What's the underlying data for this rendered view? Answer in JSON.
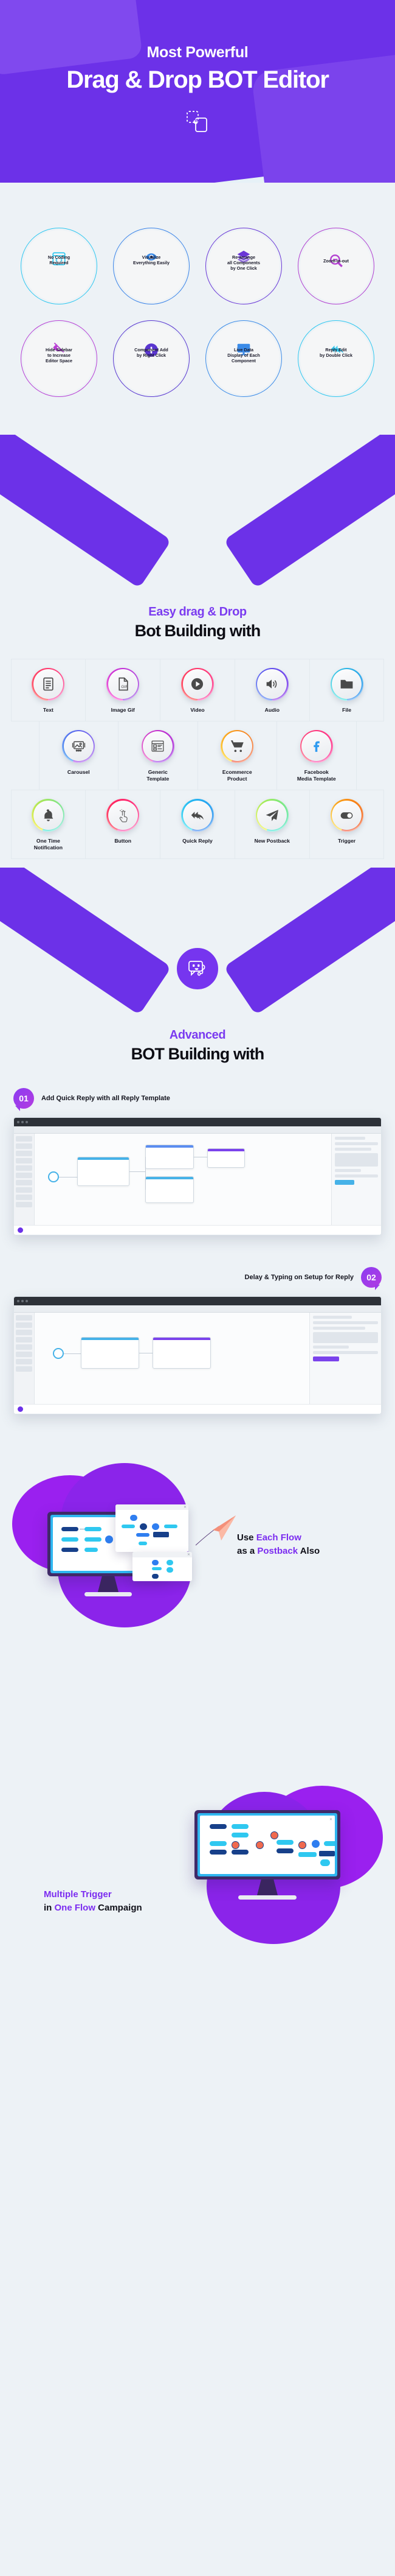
{
  "hero": {
    "subtitle": "Most Powerful",
    "title": "Drag & Drop BOT Editor",
    "icon": "drag-drop-icon"
  },
  "features": [
    {
      "icon": "code-window-icon",
      "color": "#2fc8f0",
      "lines": [
        "No Coding",
        "Required"
      ]
    },
    {
      "icon": "eye-icon",
      "color": "#3b84e8",
      "lines": [
        "Visualize",
        "Everything Easily"
      ]
    },
    {
      "icon": "layers-icon",
      "color": "#6a36d6",
      "lines": [
        "Re-arrange",
        "all Components",
        "by One Click"
      ]
    },
    {
      "icon": "zoom-out-icon",
      "color": "#b23fd0",
      "lines": [
        "Zoom-in-out"
      ]
    },
    {
      "icon": "eye-slash-icon",
      "color": "#b83fd4",
      "lines": [
        "Hide Sidebar",
        "to Increase",
        "Editor Space"
      ]
    },
    {
      "icon": "plus-circle-icon",
      "color": "#5a36d0",
      "lines": [
        "Component Add",
        "by Right Click"
      ]
    },
    {
      "icon": "monitor-icon",
      "color": "#3b8be8",
      "lines": [
        "Live Data",
        "Display of Each",
        "Component"
      ]
    },
    {
      "icon": "reply-all-icon",
      "color": "#2fc8f0",
      "lines": [
        "Reply Edit",
        "by Double Click"
      ]
    }
  ],
  "section_drag": {
    "kicker": "Easy drag & Drop",
    "title": "Bot Building with"
  },
  "components": [
    {
      "label": "Text",
      "icon": "document-text-icon",
      "c1": "#ff2a2a",
      "c2": "#ff2a9d"
    },
    {
      "label": "Image Gif",
      "icon": "gif-file-icon",
      "c1": "#ff26c8",
      "c2": "#7b1fe0"
    },
    {
      "label": "Video",
      "icon": "play-circle-icon",
      "c1": "#ff2020",
      "c2": "#ff2a9d"
    },
    {
      "label": "Audio",
      "icon": "speaker-icon",
      "c1": "#1a5cf0",
      "c2": "#8a1fe8"
    },
    {
      "label": "File",
      "icon": "folder-icon",
      "c1": "#16e0d8",
      "c2": "#1a7df0"
    },
    {
      "label": "Carousel",
      "icon": "carousel-icon",
      "c1": "#1a8bf0",
      "c2": "#9b1fe8"
    },
    {
      "label": "Generic\nTemplate",
      "icon": "generic-template-icon",
      "c1": "#e81fb0",
      "c2": "#8a1fe8"
    },
    {
      "label": "Ecommerce\nProduct",
      "icon": "shopping-cart-icon",
      "c1": "#ffd400",
      "c2": "#f02a10"
    },
    {
      "label": "Facebook\nMedia Template",
      "icon": "facebook-icon",
      "c1": "#ff1f4e",
      "c2": "#ff2a9d"
    },
    {
      "label": "One Time\nNotification",
      "icon": "bell-icon",
      "c1": "#f5e800",
      "c2": "#16e0d8"
    },
    {
      "label": "Button",
      "icon": "tap-finger-icon",
      "c1": "#ff1030",
      "c2": "#ff2aa0"
    },
    {
      "label": "Quick Reply",
      "icon": "reply-all-icon",
      "c1": "#16ddf0",
      "c2": "#1a6df0"
    },
    {
      "label": "New Postback",
      "icon": "paper-plane-icon",
      "c1": "#e8f000",
      "c2": "#16e0d8"
    },
    {
      "label": "Trigger",
      "icon": "toggle-icon",
      "c1": "#ffd400",
      "c2": "#f02a10"
    }
  ],
  "section_advanced": {
    "kicker": "Advanced",
    "title": "BOT Building with",
    "badge_icon": "chatbot-icon"
  },
  "steps": [
    {
      "number": "01",
      "text": "Add Quick Reply with all Reply Template",
      "align": "left"
    },
    {
      "number": "02",
      "text": "Delay & Typing on Setup for Reply",
      "align": "right"
    }
  ],
  "promos": [
    {
      "align": "right",
      "lines": [
        [
          {
            "t": "Use ",
            "hl": false
          },
          {
            "t": "Each Flow",
            "hl": true
          }
        ],
        [
          {
            "t": "as a ",
            "hl": false
          },
          {
            "t": "Postback",
            "hl": true
          },
          {
            "t": " Also",
            "hl": false
          }
        ]
      ]
    },
    {
      "align": "left",
      "lines": [
        [
          {
            "t": "Multiple Trigger",
            "hl": true
          }
        ],
        [
          {
            "t": "in ",
            "hl": false
          },
          {
            "t": "One Flow",
            "hl": true
          },
          {
            "t": " Campaign",
            "hl": false
          }
        ]
      ]
    }
  ],
  "colors": {
    "brand_purple": "#6c31e8",
    "accent_violet": "#7b3cf0",
    "page_bg": "#edf2f6",
    "hero_bg": "#e6f1f7"
  }
}
